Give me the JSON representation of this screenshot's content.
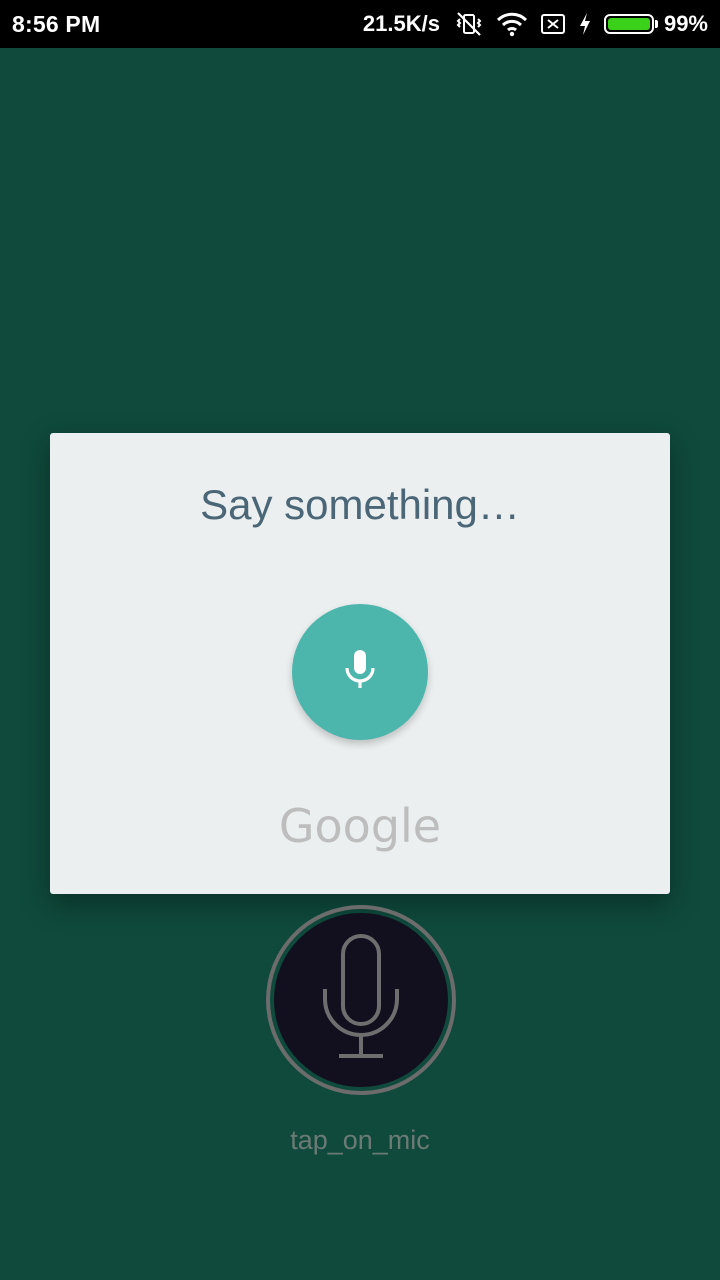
{
  "status_bar": {
    "time": "8:56 PM",
    "network_speed": "21.5K/s",
    "battery_percent_text": "99%",
    "battery_level": 0.99,
    "icons": [
      "vibrate-off-icon",
      "wifi-icon",
      "sim-none-icon",
      "charging-icon",
      "battery-icon"
    ]
  },
  "dialog": {
    "title": "Say something…",
    "mic_icon": "mic-icon",
    "brand_text": "Google",
    "mic_color": "#4db6ac"
  },
  "main": {
    "mic_button_icon": "mic-outline-icon",
    "mic_label": "tap_on_mic"
  },
  "colors": {
    "background": "#0f4a3c",
    "dialog_bg": "#ebeff0",
    "title_color": "#4b6777"
  }
}
